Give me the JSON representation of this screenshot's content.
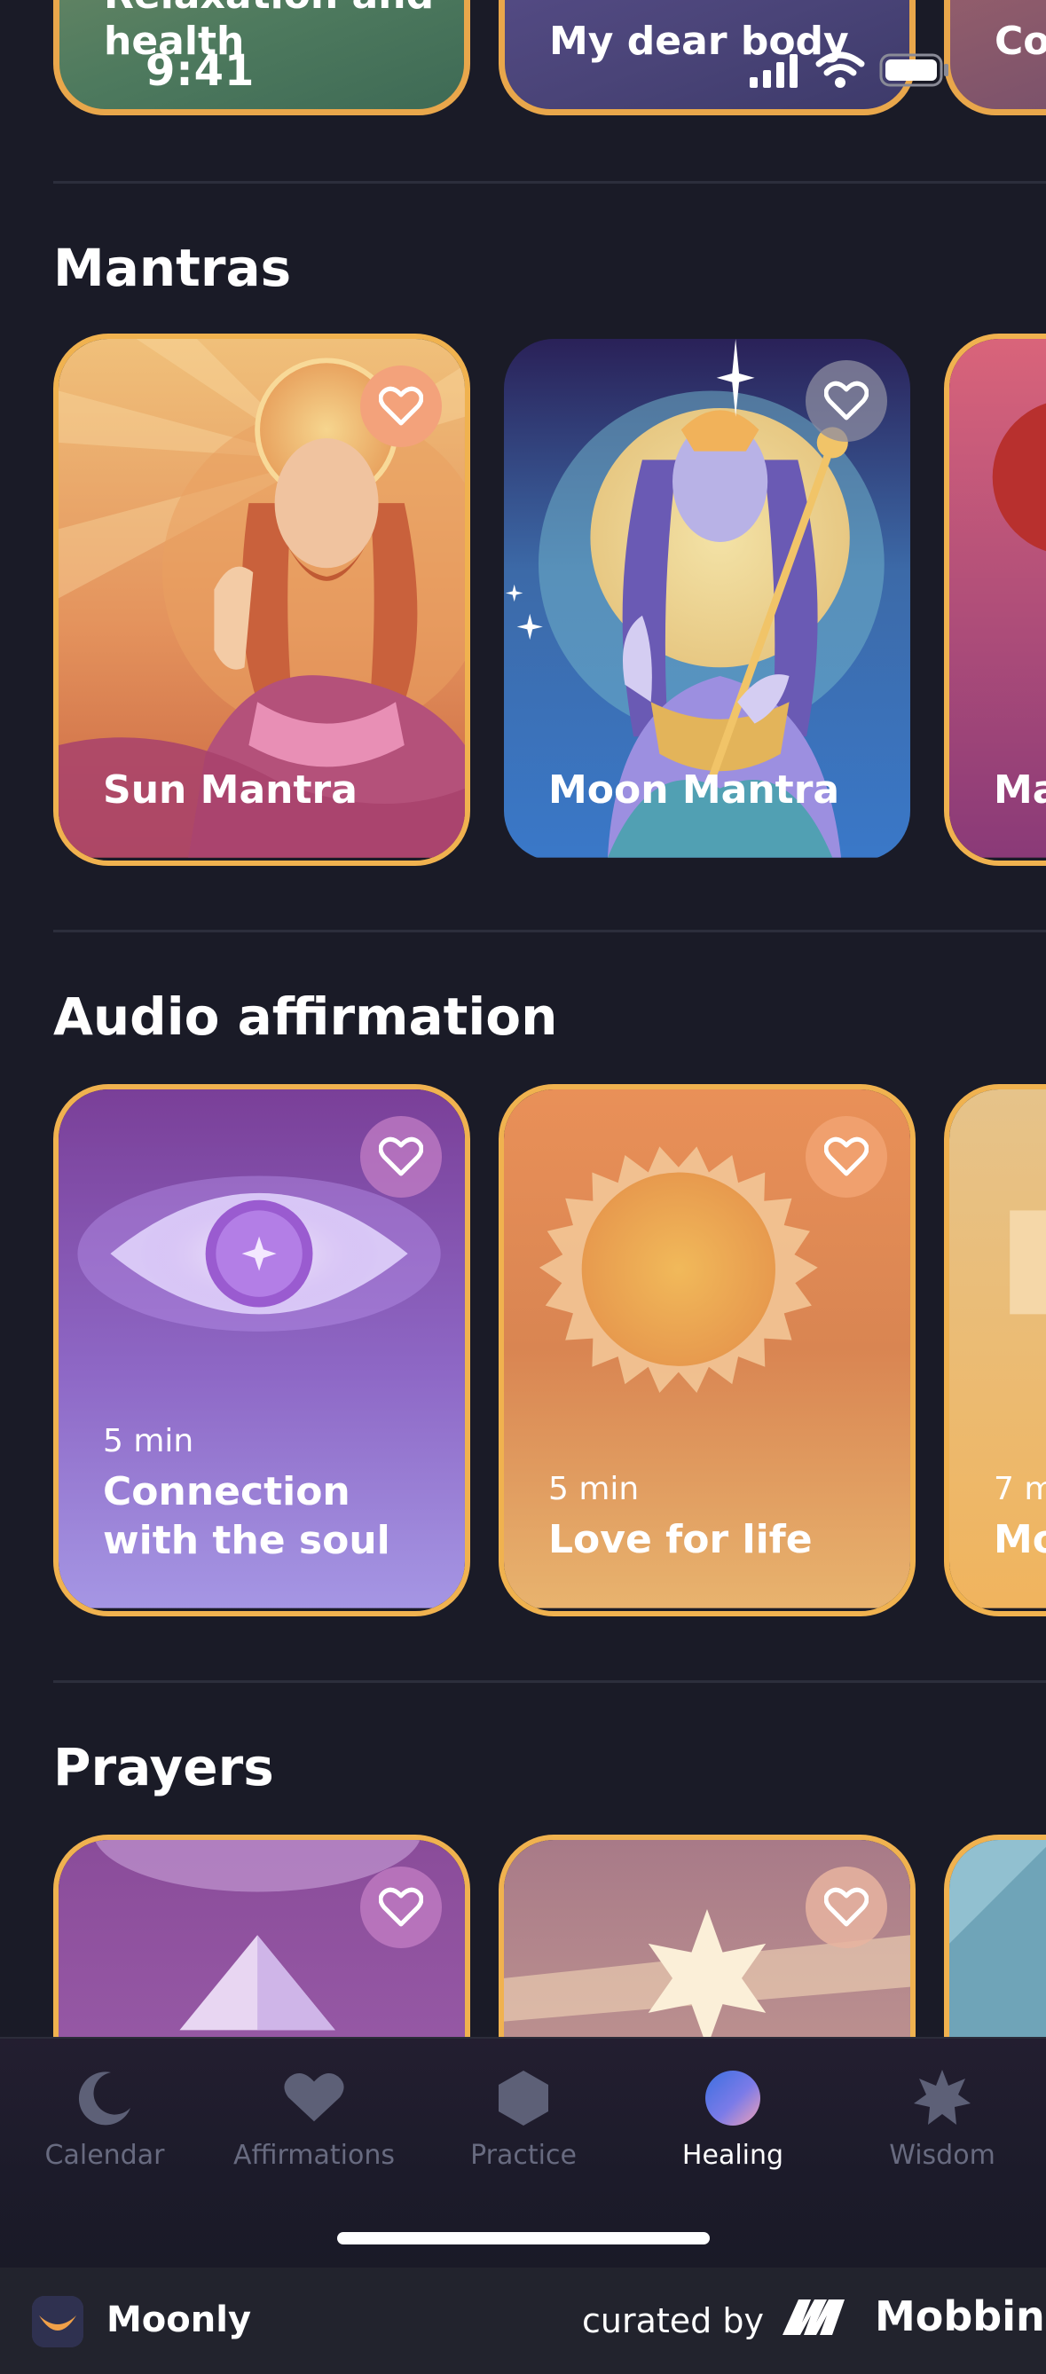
{
  "status_bar": {
    "time": "9:41"
  },
  "top_row": [
    {
      "title": "Relaxation and health"
    },
    {
      "title": "My dear body"
    },
    {
      "title": "Co and"
    }
  ],
  "sections": {
    "mantras": {
      "title": "Mantras",
      "cards": [
        {
          "name": "Sun Mantra"
        },
        {
          "name": "Moon Mantra"
        },
        {
          "name": "Ma"
        }
      ]
    },
    "audio": {
      "title": "Audio affirmation",
      "cards": [
        {
          "duration": "5 min",
          "name": "Connection with the soul"
        },
        {
          "duration": "5 min",
          "name": "Love for life"
        },
        {
          "duration": "7 m",
          "name": "Mo"
        }
      ]
    },
    "prayers": {
      "title": "Prayers"
    }
  },
  "tabbar": {
    "items": [
      {
        "label": "Calendar",
        "icon": "moon-icon"
      },
      {
        "label": "Affirmations",
        "icon": "heart-icon"
      },
      {
        "label": "Practice",
        "icon": "hexagon-icon"
      },
      {
        "label": "Healing",
        "icon": "healing-orb-icon",
        "active": true
      },
      {
        "label": "Wisdom",
        "icon": "star-icon"
      }
    ]
  },
  "brandbar": {
    "app_name": "Moonly",
    "curated_by": "curated by",
    "curator": "Mobbin"
  },
  "colors": {
    "background": "#1a1b27",
    "card_border": "#f0b24f",
    "inactive_tab": "#686b80"
  }
}
